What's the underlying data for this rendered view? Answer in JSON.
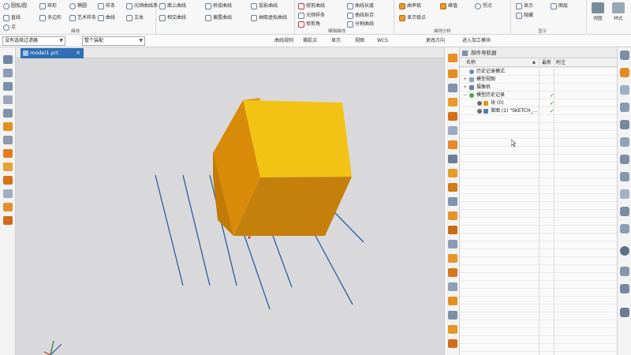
{
  "ribbon": {
    "sketch_items": [
      {
        "label": "圆弧/圆",
        "icon": "arc-icon"
      },
      {
        "label": "矩形",
        "icon": "rectangle-icon"
      },
      {
        "label": "椭圆",
        "icon": "ellipse-icon"
      },
      {
        "label": "样条",
        "icon": "spline-icon"
      },
      {
        "label": "光顺曲线串",
        "icon": "smooth-curve-icon"
      },
      {
        "label": "直线",
        "icon": "line-icon"
      },
      {
        "label": "多边形",
        "icon": "polygon-icon"
      },
      {
        "label": "艺术样条",
        "icon": "art-spline-icon"
      },
      {
        "label": "曲线",
        "icon": "curve-icon"
      },
      {
        "label": "文本",
        "icon": "text-icon"
      },
      {
        "label": "点",
        "icon": "point-icon"
      }
    ],
    "curve_items": [
      {
        "label": "面上曲线",
        "icon": "curve-on-face-icon"
      },
      {
        "label": "桥接曲线",
        "icon": "bridge-curve-icon"
      },
      {
        "label": "投影曲线",
        "icon": "project-curve-icon"
      },
      {
        "label": "相交曲线",
        "icon": "intersect-curve-icon"
      },
      {
        "label": "偏置曲线",
        "icon": "offset-curve-icon"
      },
      {
        "label": "抽取虚拟曲线",
        "icon": "extract-curve-icon"
      }
    ],
    "sketch_group_label": "曲线",
    "edit_items": [
      {
        "label": "修剪曲线",
        "icon": "trim-curve-icon"
      },
      {
        "label": "曲线长度",
        "icon": "curve-length-icon"
      },
      {
        "label": "光顺样条",
        "icon": "smooth-spline-icon"
      },
      {
        "label": "曲线拟合",
        "icon": "fit-curve-icon"
      },
      {
        "label": "修剪角",
        "icon": "trim-corner-icon"
      },
      {
        "label": "分割曲线",
        "icon": "divide-curve-icon"
      }
    ],
    "edit_group_label": "编辑曲线",
    "analysis_items": [
      {
        "label": "曲率梳",
        "icon": "curvature-comb-icon"
      },
      {
        "label": "峰值",
        "icon": "peak-icon"
      },
      {
        "label": "拐点",
        "icon": "inflection-icon"
      },
      {
        "label": "显示极点",
        "icon": "show-poles-icon"
      }
    ],
    "analysis_group_label": "曲线分析",
    "feature_items": [
      {
        "label": "显示",
        "icon": "display-icon"
      },
      {
        "label": "隐藏",
        "icon": "hide-icon"
      },
      {
        "label": "图层",
        "icon": "layer-icon"
      }
    ],
    "feature_group_label": "显示",
    "big_buttons": [
      {
        "label": "视图",
        "icon": "view-icon"
      },
      {
        "label": "样式",
        "icon": "style-icon"
      }
    ],
    "view_group_label": "视图"
  },
  "toolbar2": {
    "filter_combo": "没有选择过滤器",
    "scope_combo": "整个装配",
    "items": [
      {
        "label": "曲线规则",
        "icon": "curve-rule-icon"
      },
      {
        "label": "捕捉点",
        "icon": "snap-icon"
      },
      {
        "label": "显示",
        "icon": "show-icon"
      },
      {
        "label": "视图",
        "icon": "view-menu-icon"
      },
      {
        "label": "WCS",
        "icon": "wcs-icon"
      },
      {
        "label": "更改方向",
        "icon": "change-orient-icon"
      },
      {
        "label": "进入加工模块",
        "icon": "enter-cam-icon"
      }
    ]
  },
  "document": {
    "tab_label": "model1.prt",
    "close": "×"
  },
  "navigator": {
    "title": "部件导航器",
    "columns": {
      "name": "名称",
      "up": "▲",
      "latest": "最新",
      "note": "附注"
    },
    "rows": [
      {
        "label": "历史记录模式",
        "indent": 0,
        "expand": "",
        "icon": "history-icon",
        "check": ""
      },
      {
        "label": "模型视图",
        "indent": 0,
        "expand": "+",
        "icon": "model-views-icon",
        "check": ""
      },
      {
        "label": "摄像机",
        "indent": 0,
        "expand": "+",
        "icon": "camera-icon",
        "check": ""
      },
      {
        "label": "模型历史记录",
        "indent": 0,
        "expand": "−",
        "icon": "model-history-icon",
        "check": "✓"
      },
      {
        "label": "块 (0)",
        "indent": 1,
        "expand": "",
        "icon": "block-icon",
        "check": "✓"
      },
      {
        "label": "草图 (1) \"SKETCH_...",
        "indent": 1,
        "expand": "",
        "icon": "sketch-icon",
        "check": "✓"
      }
    ]
  },
  "colors": {
    "cube_top": "#f2c315",
    "cube_front": "#c17a06",
    "cube_right": "#e99e0d",
    "accent": "#2f6fb4",
    "sketch_line": "#2b5d9b"
  }
}
